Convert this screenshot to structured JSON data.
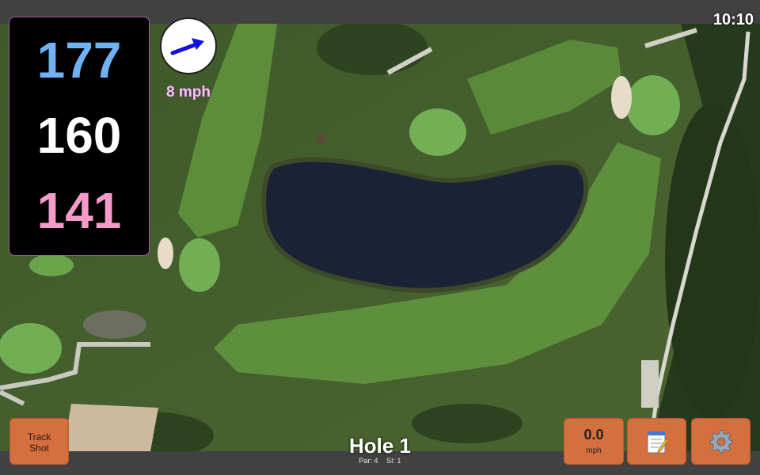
{
  "clock": {
    "time": "10:10"
  },
  "yardages": {
    "back": "177",
    "middle": "160",
    "front": "141"
  },
  "wind": {
    "speed_label": "8 mph",
    "arrow_icon": "wind-direction-arrow-icon",
    "arrow_color": "#1010e0"
  },
  "hole": {
    "title": "Hole 1",
    "par": "Par: 4",
    "si": "SI: 1"
  },
  "buttons": {
    "track_shot": "Track Shot",
    "speed_value": "0.0",
    "speed_unit": "mph",
    "notes_icon": "notepad-icon",
    "settings_icon": "gear-icon"
  },
  "colors": {
    "button": "#d56f3e",
    "back_yardage": "#6fb3f5",
    "middle_yardage": "#ffffff",
    "front_yardage": "#f59ac9",
    "wind_text": "#f0c7f3"
  }
}
